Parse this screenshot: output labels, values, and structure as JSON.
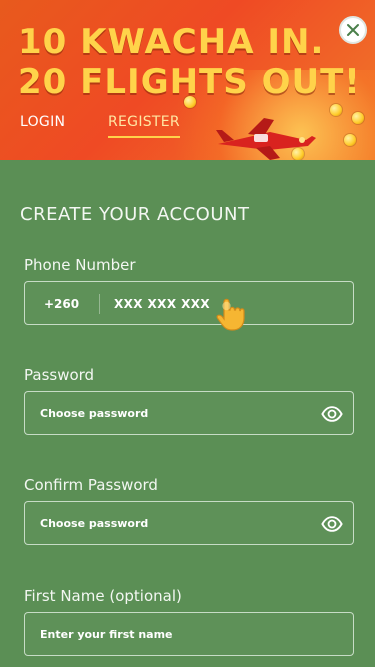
{
  "banner": {
    "headline_line1": "10 KWACHA IN.",
    "headline_line2": "20 FLIGHTS OUT!",
    "tabs": [
      {
        "label": "LOGIN"
      },
      {
        "label": "REGISTER"
      }
    ],
    "close_icon": "close-icon"
  },
  "form": {
    "title": "CREATE YOUR ACCOUNT",
    "fields": {
      "phone": {
        "label": "Phone Number",
        "prefix": "+260",
        "placeholder": "XXX XXX XXX"
      },
      "password": {
        "label": "Password",
        "placeholder": "Choose password",
        "icon": "eye-icon"
      },
      "confirm_password": {
        "label": "Confirm Password",
        "placeholder": "Choose password",
        "icon": "eye-icon"
      },
      "first_name": {
        "label": "First Name (optional)",
        "placeholder": "Enter your first name"
      }
    }
  },
  "colors": {
    "banner_orange": "#ef4a24",
    "headline_yellow": "#ffd34a",
    "form_green": "#5b8f55"
  }
}
